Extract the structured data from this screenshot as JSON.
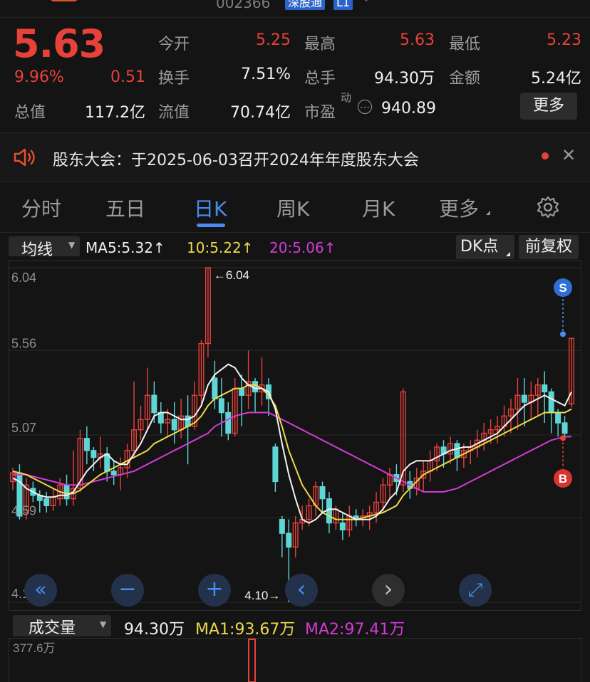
{
  "header": {
    "code": "002366",
    "tag_connect": "深股通",
    "tag_level": "L1"
  },
  "quote": {
    "price": "5.63",
    "change_pct": "9.96%",
    "change": "0.51",
    "total_value_label": "总值",
    "total_value": "117.2亿",
    "fields": [
      {
        "label": "今开",
        "value": "5.25"
      },
      {
        "label": "最高",
        "value": "5.63"
      },
      {
        "label": "最低",
        "value": "5.23"
      },
      {
        "label": "换手",
        "value": "7.51%"
      },
      {
        "label": "总手",
        "value": "94.30万"
      },
      {
        "label": "金额",
        "value": "5.24亿"
      },
      {
        "label": "流值",
        "value": "70.74亿"
      },
      {
        "label": "市盈",
        "value": "940.89"
      }
    ],
    "pe_superscript": "动",
    "more_label": "更多"
  },
  "notice": {
    "text": "股东大会：于2025-06-03召开2024年年度股东大会",
    "close_glyph": "✕"
  },
  "tabs": [
    "分时",
    "五日",
    "日K",
    "周K",
    "月K",
    "更多"
  ],
  "active_tab": "日K",
  "indicator_bar": {
    "select_label": "均线",
    "ma5": "MA5:5.32↑",
    "ma10": "10:5.22↑",
    "ma20": "20:5.06↑",
    "dk_label": "DK点",
    "fq_label": "前复权"
  },
  "colors": {
    "up": "#e8413a",
    "down": "#5ed6d6",
    "ma5": "#f2f2f2",
    "ma10": "#ecd94a",
    "ma20": "#d33bd6",
    "accent": "#4a8cf0"
  },
  "chart_data": {
    "type": "candlestick",
    "y_ticks": [
      "6.04",
      "5.56",
      "5.07",
      "4.59",
      "4.10"
    ],
    "ylim": [
      4.1,
      6.04
    ],
    "high_marker": "←6.04",
    "low_marker": "4.10→",
    "signal_sell": "S",
    "signal_buy": "B",
    "candles": [
      [
        4.8,
        4.85,
        4.75,
        4.88
      ],
      [
        4.85,
        4.6,
        4.58,
        4.9
      ],
      [
        4.62,
        4.78,
        4.58,
        4.82
      ],
      [
        4.76,
        4.72,
        4.68,
        4.8
      ],
      [
        4.72,
        4.69,
        4.62,
        4.75
      ],
      [
        4.7,
        4.66,
        4.62,
        4.74
      ],
      [
        4.66,
        4.71,
        4.63,
        4.76
      ],
      [
        4.7,
        4.78,
        4.66,
        4.82
      ],
      [
        4.78,
        4.7,
        4.66,
        4.84
      ],
      [
        4.7,
        4.76,
        4.66,
        4.98
      ],
      [
        4.76,
        5.05,
        4.74,
        5.1
      ],
      [
        5.05,
        4.98,
        4.9,
        5.12
      ],
      [
        4.98,
        4.94,
        4.86,
        5.0
      ],
      [
        4.94,
        4.96,
        4.88,
        5.06
      ],
      [
        4.96,
        4.86,
        4.8,
        5.0
      ],
      [
        4.86,
        4.84,
        4.78,
        4.92
      ],
      [
        4.84,
        4.88,
        4.75,
        4.94
      ],
      [
        4.88,
        4.98,
        4.82,
        5.02
      ],
      [
        4.98,
        5.1,
        4.94,
        5.38
      ],
      [
        5.1,
        5.16,
        5.04,
        5.24
      ],
      [
        5.16,
        5.3,
        5.1,
        5.46
      ],
      [
        5.3,
        5.2,
        5.14,
        5.38
      ],
      [
        5.2,
        5.14,
        5.08,
        5.26
      ],
      [
        5.14,
        5.16,
        5.06,
        5.22
      ],
      [
        5.16,
        5.1,
        5.02,
        5.26
      ],
      [
        5.1,
        5.18,
        5.05,
        5.28
      ],
      [
        5.18,
        5.12,
        4.9,
        5.3
      ],
      [
        5.12,
        5.3,
        5.1,
        5.38
      ],
      [
        5.3,
        5.6,
        5.24,
        5.62
      ],
      [
        5.6,
        6.04,
        5.52,
        6.04
      ],
      [
        5.4,
        5.28,
        5.22,
        5.5
      ],
      [
        5.28,
        5.2,
        5.06,
        5.4
      ],
      [
        5.2,
        5.08,
        5.04,
        5.26
      ],
      [
        5.08,
        5.34,
        5.06,
        5.4
      ],
      [
        5.34,
        5.3,
        5.12,
        5.42
      ],
      [
        5.3,
        5.38,
        5.22,
        5.56
      ],
      [
        5.38,
        5.32,
        5.2,
        5.4
      ],
      [
        5.32,
        5.36,
        5.24,
        5.52
      ],
      [
        5.36,
        5.28,
        5.18,
        5.4
      ],
      [
        5.0,
        4.8,
        4.74,
        5.02
      ],
      [
        4.58,
        4.5,
        4.36,
        4.6
      ],
      [
        4.5,
        4.42,
        4.1,
        4.58
      ],
      [
        4.42,
        4.56,
        4.36,
        4.6
      ],
      [
        4.56,
        4.58,
        4.52,
        4.66
      ],
      [
        4.58,
        4.66,
        4.54,
        4.7
      ],
      [
        4.66,
        4.77,
        4.6,
        4.8
      ],
      [
        4.77,
        4.7,
        4.62,
        4.8
      ],
      [
        4.7,
        4.56,
        4.5,
        4.74
      ],
      [
        4.56,
        4.64,
        4.52,
        4.66
      ],
      [
        4.56,
        4.52,
        4.46,
        4.62
      ],
      [
        4.52,
        4.6,
        4.48,
        4.66
      ],
      [
        4.6,
        4.58,
        4.54,
        4.64
      ],
      [
        4.58,
        4.6,
        4.54,
        4.64
      ],
      [
        4.6,
        4.62,
        4.52,
        4.66
      ],
      [
        4.62,
        4.68,
        4.56,
        4.74
      ],
      [
        4.68,
        4.78,
        4.62,
        4.82
      ],
      [
        4.78,
        4.84,
        4.7,
        4.88
      ],
      [
        4.84,
        4.8,
        4.72,
        4.9
      ],
      [
        4.78,
        5.32,
        4.74,
        5.34
      ],
      [
        4.8,
        4.76,
        4.7,
        4.86
      ],
      [
        4.76,
        4.82,
        4.72,
        4.88
      ],
      [
        4.82,
        4.86,
        4.74,
        4.92
      ],
      [
        4.86,
        4.92,
        4.8,
        4.98
      ],
      [
        4.92,
        5.0,
        4.86,
        5.02
      ],
      [
        5.0,
        4.96,
        4.88,
        5.04
      ],
      [
        4.96,
        5.02,
        4.9,
        5.06
      ],
      [
        5.02,
        4.94,
        4.86,
        5.04
      ],
      [
        4.94,
        4.98,
        4.88,
        5.02
      ],
      [
        4.98,
        5.0,
        4.9,
        5.04
      ],
      [
        5.0,
        5.04,
        4.94,
        5.1
      ],
      [
        5.04,
        5.08,
        4.98,
        5.14
      ],
      [
        5.08,
        5.1,
        5.02,
        5.16
      ],
      [
        5.1,
        5.12,
        5.02,
        5.18
      ],
      [
        5.12,
        5.18,
        5.06,
        5.24
      ],
      [
        5.18,
        5.22,
        5.08,
        5.28
      ],
      [
        5.22,
        5.3,
        5.1,
        5.4
      ],
      [
        5.3,
        5.26,
        5.12,
        5.4
      ],
      [
        5.26,
        5.3,
        5.16,
        5.38
      ],
      [
        5.3,
        5.36,
        5.18,
        5.4
      ],
      [
        5.36,
        5.32,
        5.14,
        5.44
      ],
      [
        5.32,
        5.2,
        5.08,
        5.34
      ],
      [
        5.2,
        5.14,
        5.06,
        5.22
      ],
      [
        5.14,
        5.08,
        5.04,
        5.18
      ],
      [
        5.25,
        5.63,
        5.23,
        5.63
      ]
    ],
    "ma5": [
      4.82,
      4.8,
      4.76,
      4.74,
      4.72,
      4.71,
      4.71,
      4.72,
      4.72,
      4.74,
      4.8,
      4.86,
      4.9,
      4.94,
      4.96,
      4.92,
      4.9,
      4.9,
      4.96,
      5.02,
      5.1,
      5.18,
      5.2,
      5.2,
      5.18,
      5.16,
      5.16,
      5.18,
      5.24,
      5.36,
      5.42,
      5.45,
      5.48,
      5.46,
      5.4,
      5.36,
      5.34,
      5.34,
      5.32,
      5.22,
      5.02,
      4.84,
      4.7,
      4.58,
      4.56,
      4.58,
      4.62,
      4.64,
      4.64,
      4.62,
      4.6,
      4.58,
      4.58,
      4.58,
      4.6,
      4.64,
      4.7,
      4.74,
      4.86,
      4.9,
      4.92,
      4.92,
      4.92,
      4.94,
      4.96,
      4.98,
      4.99,
      5.0,
      5.0,
      5.02,
      5.04,
      5.06,
      5.08,
      5.12,
      5.16,
      5.2,
      5.24,
      5.26,
      5.28,
      5.3,
      5.28,
      5.26,
      5.24,
      5.32
    ],
    "ma10": [
      4.86,
      4.85,
      4.84,
      4.82,
      4.8,
      4.78,
      4.76,
      4.74,
      4.73,
      4.73,
      4.75,
      4.78,
      4.81,
      4.84,
      4.86,
      4.88,
      4.9,
      4.92,
      4.94,
      4.96,
      4.98,
      5.02,
      5.04,
      5.06,
      5.08,
      5.1,
      5.12,
      5.14,
      5.18,
      5.24,
      5.28,
      5.3,
      5.32,
      5.34,
      5.34,
      5.36,
      5.36,
      5.34,
      5.3,
      5.24,
      5.12,
      4.98,
      4.88,
      4.78,
      4.72,
      4.66,
      4.62,
      4.6,
      4.58,
      4.58,
      4.58,
      4.58,
      4.59,
      4.6,
      4.61,
      4.62,
      4.64,
      4.66,
      4.72,
      4.76,
      4.8,
      4.84,
      4.86,
      4.88,
      4.9,
      4.92,
      4.94,
      4.96,
      4.98,
      5.0,
      5.02,
      5.04,
      5.06,
      5.08,
      5.1,
      5.12,
      5.14,
      5.16,
      5.18,
      5.2,
      5.2,
      5.2,
      5.2,
      5.22
    ],
    "ma20": [
      4.84,
      4.84,
      4.84,
      4.83,
      4.82,
      4.81,
      4.8,
      4.79,
      4.78,
      4.78,
      4.78,
      4.79,
      4.8,
      4.81,
      4.82,
      4.83,
      4.84,
      4.85,
      4.86,
      4.88,
      4.9,
      4.92,
      4.94,
      4.96,
      4.98,
      5.0,
      5.02,
      5.04,
      5.06,
      5.08,
      5.12,
      5.14,
      5.16,
      5.18,
      5.19,
      5.2,
      5.2,
      5.2,
      5.2,
      5.18,
      5.16,
      5.14,
      5.12,
      5.1,
      5.08,
      5.06,
      5.04,
      5.02,
      5.0,
      4.98,
      4.96,
      4.94,
      4.92,
      4.9,
      4.88,
      4.86,
      4.84,
      4.82,
      4.8,
      4.78,
      4.76,
      4.74,
      4.74,
      4.74,
      4.74,
      4.75,
      4.76,
      4.78,
      4.8,
      4.82,
      4.84,
      4.86,
      4.88,
      4.9,
      4.92,
      4.94,
      4.96,
      4.98,
      5.0,
      5.02,
      5.04,
      5.05,
      5.06,
      5.06
    ]
  },
  "chart_controls": {
    "fast_back": "«",
    "zoom_out": "−",
    "zoom_in": "+",
    "prev": "‹",
    "next": "›",
    "expand": "⤢"
  },
  "volume_bar": {
    "select_label": "成交量",
    "value": "94.30万",
    "ma1": "MA1:93.67万",
    "ma2": "MA2:97.41万",
    "y_top": "377.6万"
  }
}
